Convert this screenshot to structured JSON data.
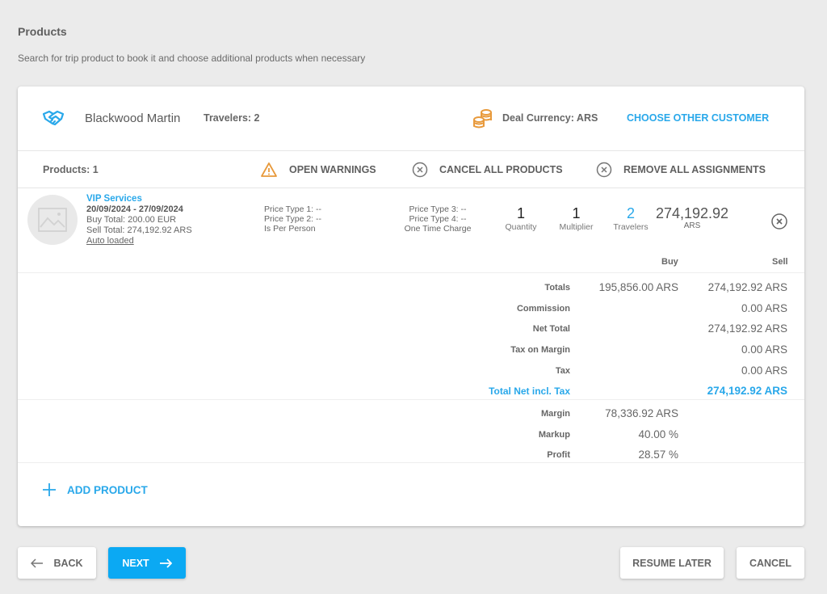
{
  "page": {
    "title": "Products",
    "subtitle": "Search for trip product to book it and choose additional products when necessary"
  },
  "customer": {
    "icon": "handshake-icon",
    "name": "Blackwood Martin",
    "travelers_label": "Travelers: 2",
    "currency_icon": "coins-icon",
    "deal_currency_label": "Deal Currency: ARS",
    "choose_other_label": "CHOOSE OTHER CUSTOMER"
  },
  "actions": {
    "products_count_label": "Products: 1",
    "open_warnings_label": "OPEN WARNINGS",
    "cancel_all_label": "CANCEL ALL PRODUCTS",
    "remove_assignments_label": "REMOVE ALL ASSIGNMENTS"
  },
  "product": {
    "thumbnail_icon": "image-placeholder-icon",
    "name": "VIP Services",
    "dates": "20/09/2024 - 27/09/2024",
    "buy_total": "Buy Total: 200.00 EUR",
    "sell_total": "Sell Total: 274,192.92 ARS",
    "auto_loaded": "Auto loaded",
    "price_type_1": "Price Type 1: --",
    "price_type_2": "Price Type 2: --",
    "per_person": "Is Per Person",
    "price_type_3": "Price Type 3: --",
    "price_type_4": "Price Type 4: --",
    "one_time_charge": "One Time Charge",
    "quantity_value": "1",
    "quantity_label": "Quantity",
    "multiplier_value": "1",
    "multiplier_label": "Multiplier",
    "travelers_value": "2",
    "travelers_label": "Travelers",
    "sell_value": "274,192.92",
    "sell_currency": "ARS"
  },
  "summary": {
    "buy_header": "Buy",
    "sell_header": "Sell",
    "rows": [
      {
        "label": "Totals",
        "buy": "195,856.00 ARS",
        "sell": "274,192.92 ARS"
      },
      {
        "label": "Commission",
        "buy": "",
        "sell": "0.00 ARS"
      },
      {
        "label": "Net Total",
        "buy": "",
        "sell": "274,192.92 ARS"
      },
      {
        "label": "Tax on Margin",
        "buy": "",
        "sell": "0.00 ARS"
      },
      {
        "label": "Tax",
        "buy": "",
        "sell": "0.00 ARS"
      },
      {
        "label": "Total Net incl. Tax",
        "buy": "",
        "sell": "274,192.92 ARS"
      }
    ],
    "profit_rows": [
      {
        "label": "Margin",
        "buy": "78,336.92 ARS"
      },
      {
        "label": "Markup",
        "buy": "40.00 %"
      },
      {
        "label": "Profit",
        "buy": "28.57 %"
      }
    ]
  },
  "add_product_label": "ADD PRODUCT",
  "footer": {
    "back_label": "BACK",
    "next_label": "NEXT",
    "resume_later_label": "RESUME LATER",
    "cancel_label": "CANCEL"
  },
  "colors": {
    "accent": "#29a8ea",
    "primary_button": "#0ba9f3",
    "warning": "#e89a3c",
    "background": "#ebebeb"
  }
}
